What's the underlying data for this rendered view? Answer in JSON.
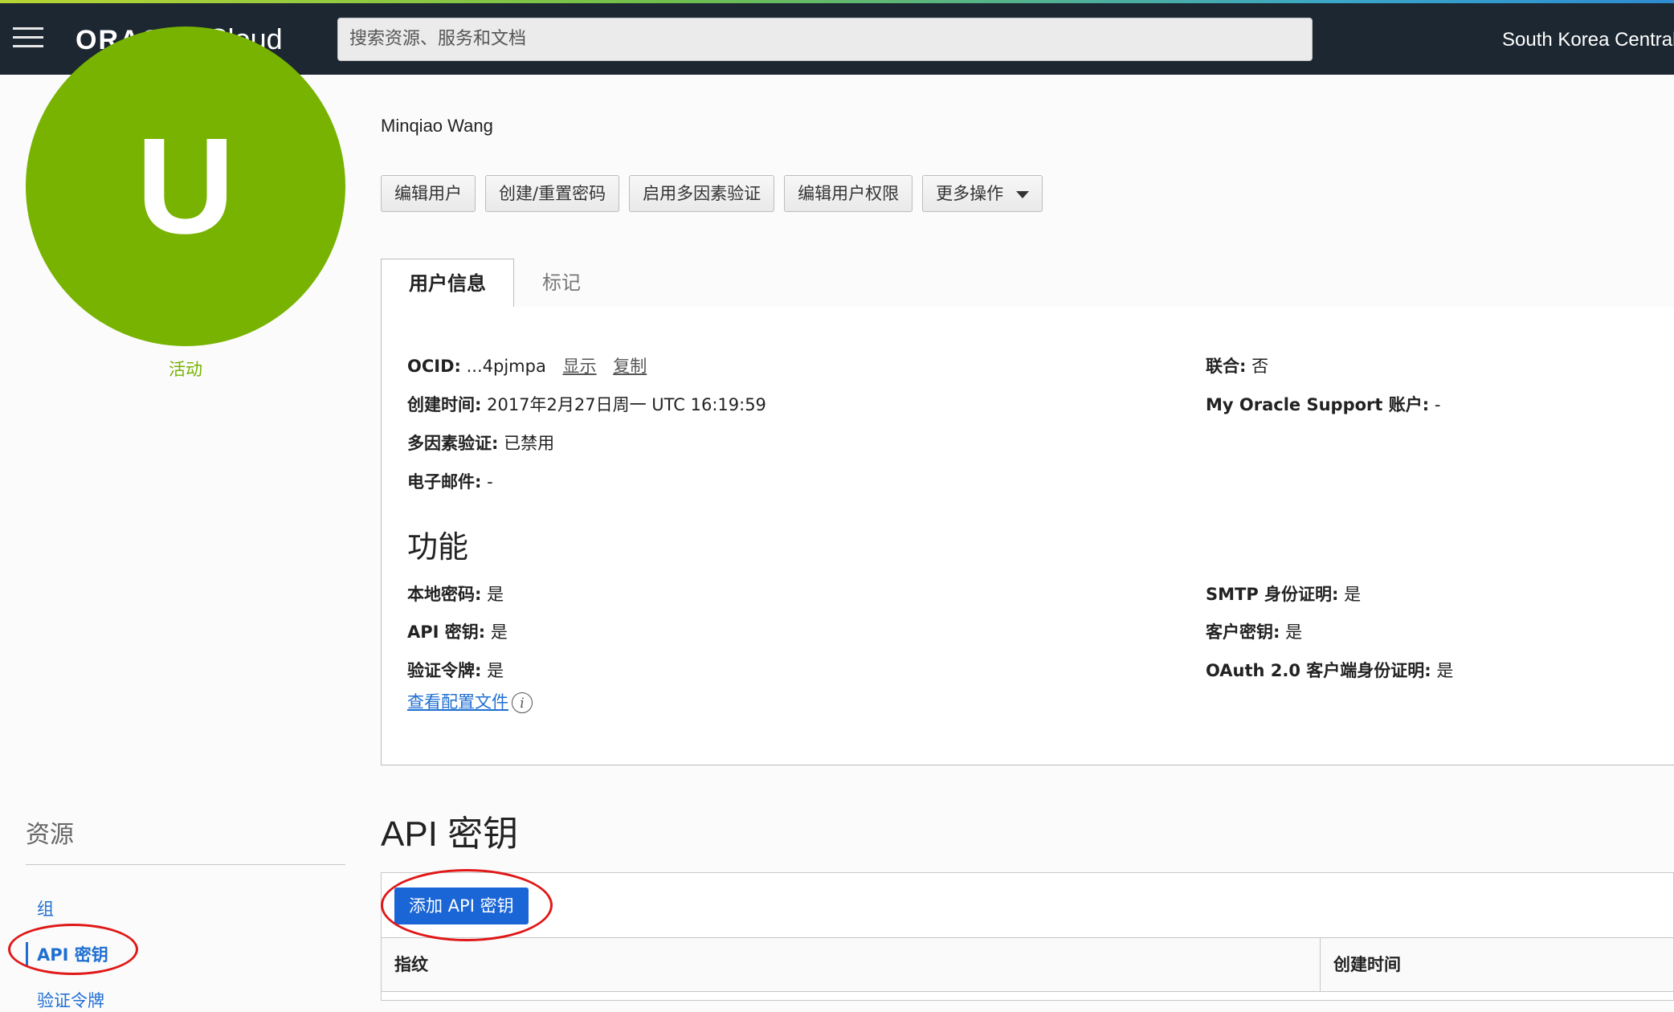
{
  "header": {
    "brand": "ORACLE",
    "product": "Cloud",
    "search_placeholder": "搜索资源、服务和文档",
    "region": "South Korea Central (Seoul)"
  },
  "user": {
    "avatar_letter": "U",
    "status": "活动",
    "name": "Minqiao Wang"
  },
  "actions": [
    "编辑用户",
    "创建/重置密码",
    "启用多因素验证",
    "编辑用户权限",
    "更多操作"
  ],
  "tabs": {
    "active": "用户信息",
    "other": "标记"
  },
  "info": {
    "ocid_label": "OCID:",
    "ocid_value": "...4pjmpa",
    "show": "显示",
    "copy": "复制",
    "created_label": "创建时间:",
    "created_value": "2017年2月27日周一 UTC 16:19:59",
    "mfa_label": "多因素验证:",
    "mfa_value": "已禁用",
    "email_label": "电子邮件:",
    "email_value": "-",
    "federated_label": "联合:",
    "federated_value": "否",
    "mos_label": "My Oracle Support 账户:",
    "mos_value": "-"
  },
  "features": {
    "title": "功能",
    "local_password_label": "本地密码:",
    "local_password_value": "是",
    "api_keys_label": "API 密钥:",
    "api_keys_value": "是",
    "auth_tokens_label": "验证令牌:",
    "auth_tokens_value": "是",
    "smtp_label": "SMTP 身份证明:",
    "smtp_value": "是",
    "customer_secret_label": "客户密钥:",
    "customer_secret_value": "是",
    "oauth_label": "OAuth 2.0 客户端身份证明:",
    "oauth_value": "是",
    "view_config": "查看配置文件",
    "info_icon": "i"
  },
  "resources": {
    "title": "资源",
    "items": [
      "组",
      "API 密钥",
      "验证令牌"
    ]
  },
  "api_keys": {
    "title": "API 密钥",
    "add_button": "添加 API 密钥",
    "columns": [
      "指纹",
      "创建时间"
    ]
  },
  "colors": {
    "topbar": "#1c2731",
    "avatar": "#77b300",
    "link": "#1f6fd1",
    "primary_button": "#1a66d6",
    "annotation": "#e01818"
  }
}
